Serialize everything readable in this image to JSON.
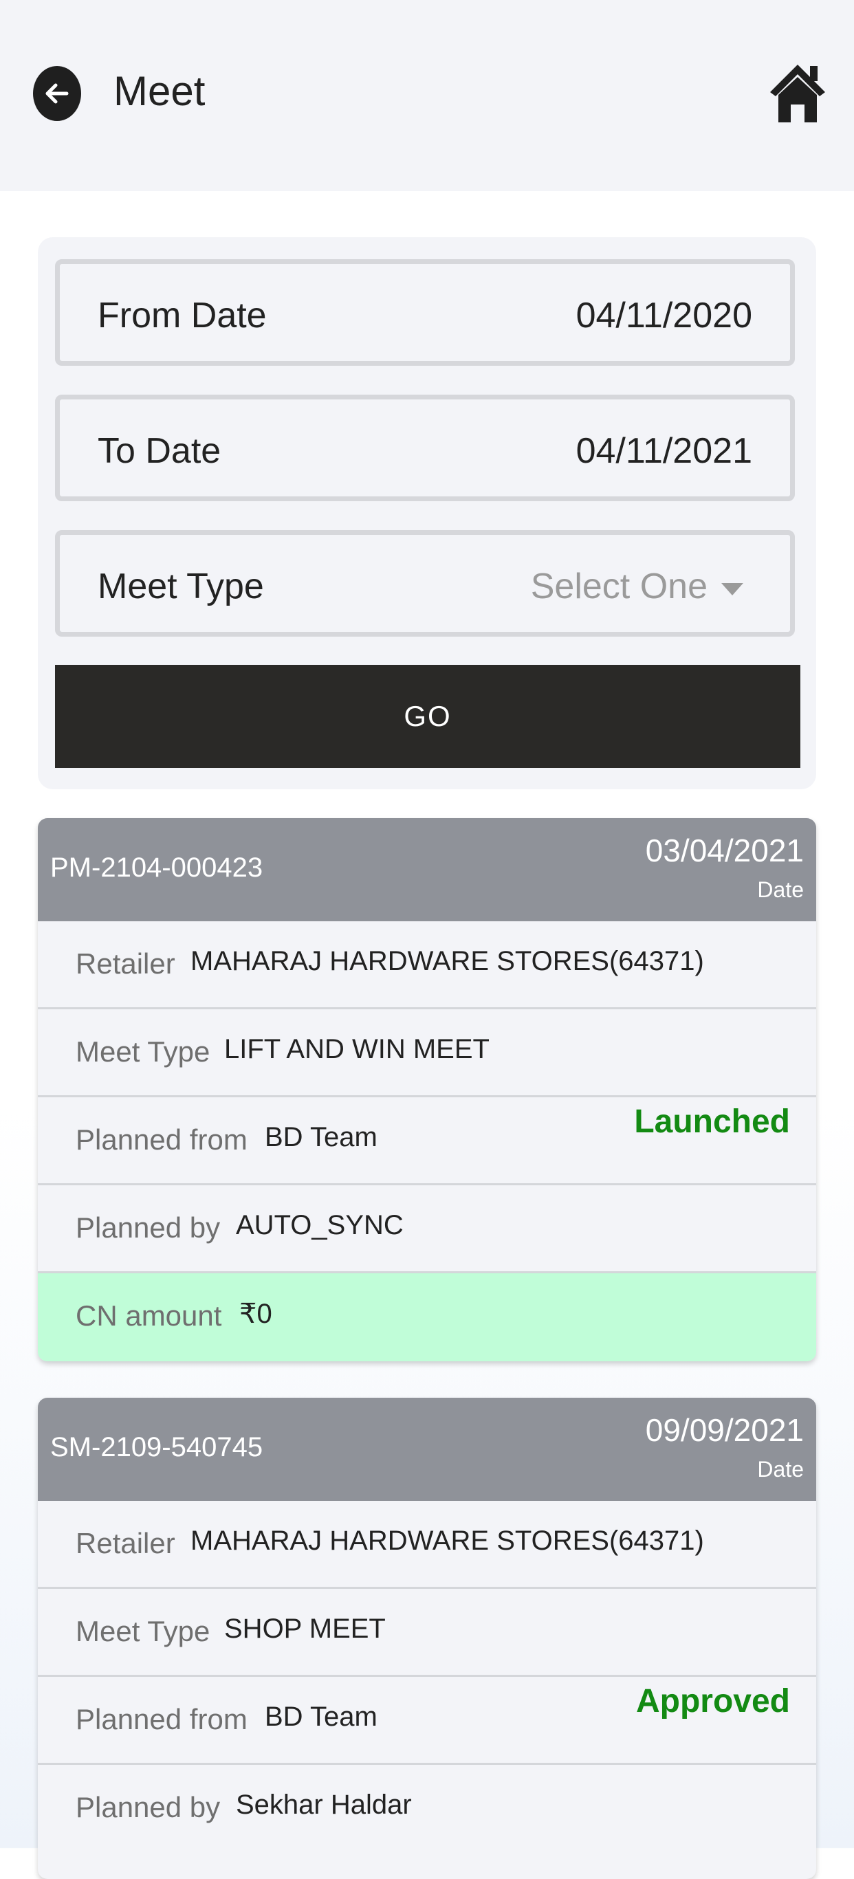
{
  "header": {
    "title": "Meet"
  },
  "filters": {
    "from_date": {
      "label": "From Date",
      "value": "04/11/2020"
    },
    "to_date": {
      "label": "To Date",
      "value": "04/11/2021"
    },
    "meet_type": {
      "label": "Meet Type",
      "placeholder": "Select One"
    },
    "go_label": "GO"
  },
  "meets": [
    {
      "id": "PM-2104-000423",
      "date": "03/04/2021",
      "date_label": "Date",
      "status": "Launched",
      "retailer_label": "Retailer",
      "retailer": "MAHARAJ HARDWARE STORES(64371)",
      "meet_type_label": "Meet Type",
      "meet_type": "LIFT AND WIN MEET",
      "planned_from_label": "Planned from",
      "planned_from": "BD Team",
      "planned_by_label": "Planned by",
      "planned_by": "AUTO_SYNC",
      "cn_label": "CN amount",
      "cn_amount": "₹0"
    },
    {
      "id": "SM-2109-540745",
      "date": "09/09/2021",
      "date_label": "Date",
      "status": "Approved",
      "retailer_label": "Retailer",
      "retailer": "MAHARAJ HARDWARE STORES(64371)",
      "meet_type_label": "Meet Type",
      "meet_type": "SHOP MEET",
      "planned_from_label": "Planned from",
      "planned_from": "BD Team",
      "planned_by_label": "Planned by",
      "planned_by": "Sekhar Haldar"
    }
  ],
  "colors": {
    "status_green": "#138a13",
    "cn_background": "#c0fdd8",
    "card_header": "#8f9299",
    "go_button": "#2a2927"
  },
  "icons": [
    "back-arrow-icon",
    "home-icon",
    "chevron-down-icon"
  ]
}
